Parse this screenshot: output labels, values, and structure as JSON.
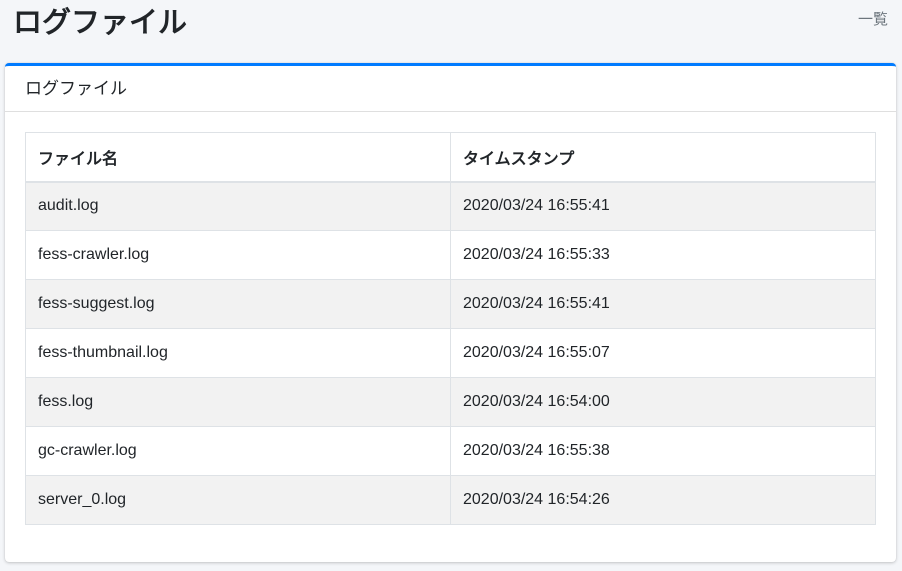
{
  "page": {
    "title": "ログファイル",
    "breadcrumb": "一覧"
  },
  "card": {
    "title": "ログファイル"
  },
  "table": {
    "headers": [
      "ファイル名",
      "タイムスタンプ"
    ],
    "rows": [
      {
        "name": "audit.log",
        "timestamp": "2020/03/24 16:55:41"
      },
      {
        "name": "fess-crawler.log",
        "timestamp": "2020/03/24 16:55:33"
      },
      {
        "name": "fess-suggest.log",
        "timestamp": "2020/03/24 16:55:41"
      },
      {
        "name": "fess-thumbnail.log",
        "timestamp": "2020/03/24 16:55:07"
      },
      {
        "name": "fess.log",
        "timestamp": "2020/03/24 16:54:00"
      },
      {
        "name": "gc-crawler.log",
        "timestamp": "2020/03/24 16:55:38"
      },
      {
        "name": "server_0.log",
        "timestamp": "2020/03/24 16:54:26"
      }
    ]
  }
}
